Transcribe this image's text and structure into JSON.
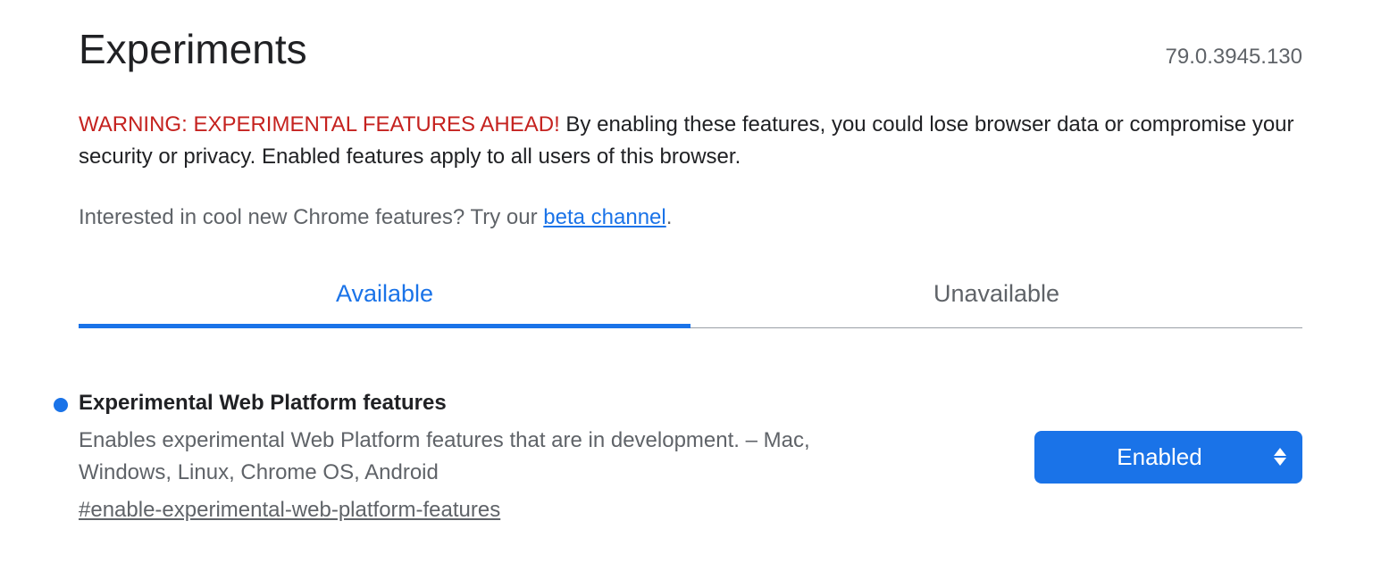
{
  "header": {
    "title": "Experiments",
    "version": "79.0.3945.130"
  },
  "warning": {
    "label": "WARNING: EXPERIMENTAL FEATURES AHEAD!",
    "text": " By enabling these features, you could lose browser data or compromise your security or privacy. Enabled features apply to all users of this browser."
  },
  "beta": {
    "prefix": "Interested in cool new Chrome features? Try our ",
    "link_text": "beta channel",
    "suffix": "."
  },
  "tabs": {
    "available": "Available",
    "unavailable": "Unavailable"
  },
  "flag": {
    "title": "Experimental Web Platform features",
    "description": "Enables experimental Web Platform features that are in development. – Mac, Windows, Linux, Chrome OS, Android",
    "hash": "#enable-experimental-web-platform-features",
    "selected": "Enabled"
  }
}
